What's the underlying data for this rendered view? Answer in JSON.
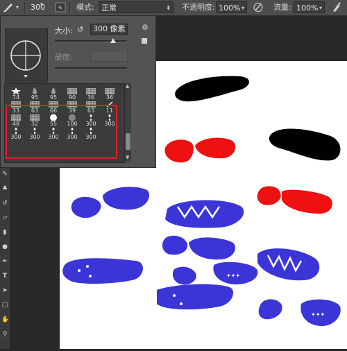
{
  "options_bar": {
    "brush_size_value": "300",
    "mode_label": "模式:",
    "mode_value": "正常",
    "opacity_label": "不透明度:",
    "opacity_value": "100%",
    "flow_label": "流量:",
    "flow_value": "100%"
  },
  "brush_panel": {
    "size_label": "大小:",
    "size_value": "300 像素",
    "hardness_label": "硬度:",
    "presets": [
      {
        "size": "74",
        "shape": "star"
      },
      {
        "size": "95",
        "shape": "drop"
      },
      {
        "size": "95",
        "shape": "drop"
      },
      {
        "size": "90",
        "shape": "texture"
      },
      {
        "size": "36",
        "shape": "texture"
      },
      {
        "size": "36",
        "shape": "texture"
      },
      {
        "size": "33",
        "shape": "texture"
      },
      {
        "size": "63",
        "shape": "texture"
      },
      {
        "size": "66",
        "shape": "texture"
      },
      {
        "size": "39",
        "shape": "texture"
      },
      {
        "size": "63",
        "shape": "texture"
      },
      {
        "size": "11",
        "shape": "dash"
      },
      {
        "size": "48",
        "shape": "texture"
      },
      {
        "size": "32",
        "shape": "texture"
      },
      {
        "size": "55",
        "shape": "circle"
      },
      {
        "size": "100",
        "shape": "soft"
      },
      {
        "size": "300",
        "shape": "foot"
      },
      {
        "size": "300",
        "shape": "foot"
      },
      {
        "size": "300",
        "shape": "foot"
      },
      {
        "size": "300",
        "shape": "foot"
      },
      {
        "size": "300",
        "shape": "foot"
      },
      {
        "size": "300",
        "shape": "foot"
      },
      {
        "size": "300",
        "shape": "foot"
      }
    ]
  },
  "colors": {
    "highlight": "#e0202a",
    "blue_print": "#3b35d8",
    "red_print": "#ee1111",
    "black_print": "#000000"
  }
}
